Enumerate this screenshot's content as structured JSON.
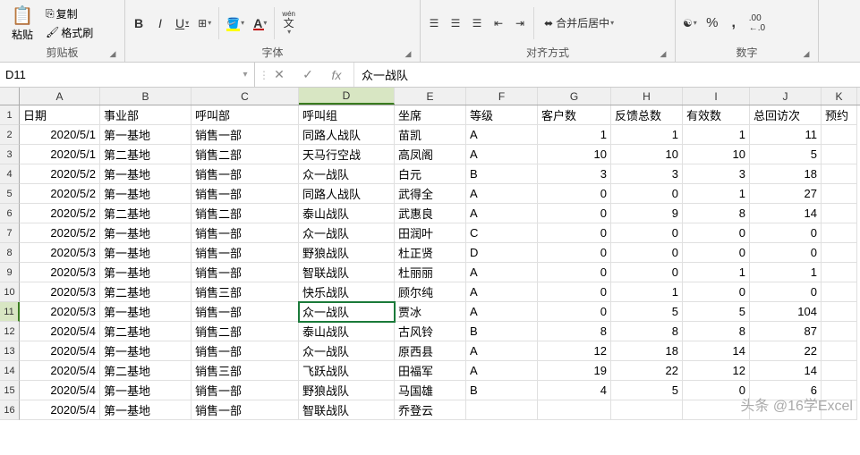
{
  "ribbon": {
    "clipboard": {
      "label": "剪贴板",
      "paste": "粘贴",
      "copy": "复制",
      "format_painter": "格式刷"
    },
    "font": {
      "label": "字体",
      "bold": "B",
      "italic": "I",
      "underline": "U",
      "wen": "wén",
      "font_color": "#c00000",
      "fill_color": "#ffff00"
    },
    "align": {
      "label": "对齐方式",
      "merge": "合并后居中"
    },
    "number": {
      "label": "数字"
    }
  },
  "name_box": "D11",
  "formula_value": "众一战队",
  "columns": [
    "A",
    "B",
    "C",
    "D",
    "E",
    "F",
    "G",
    "H",
    "I",
    "J",
    "K"
  ],
  "col_widths": [
    "cA",
    "cB",
    "cC",
    "cD",
    "cE",
    "cF",
    "cG",
    "cH",
    "cI",
    "cJ",
    "cK"
  ],
  "selected": {
    "row": 11,
    "col": "D"
  },
  "row_numbers": [
    1,
    2,
    3,
    4,
    5,
    6,
    7,
    8,
    9,
    10,
    11,
    12,
    13,
    14,
    15,
    16
  ],
  "headers": [
    "日期",
    "事业部",
    "呼叫部",
    "呼叫组",
    "坐席",
    "等级",
    "客户数",
    "反馈总数",
    "有效数",
    "总回访次",
    "预约"
  ],
  "rows": [
    [
      "2020/5/1",
      "第一基地",
      "销售一部",
      "同路人战队",
      "苗凯",
      "A",
      "1",
      "1",
      "1",
      "11",
      ""
    ],
    [
      "2020/5/1",
      "第二基地",
      "销售二部",
      "天马行空战",
      "高凤阁",
      "A",
      "10",
      "10",
      "10",
      "5",
      ""
    ],
    [
      "2020/5/2",
      "第一基地",
      "销售一部",
      "众一战队",
      "白元",
      "B",
      "3",
      "3",
      "3",
      "18",
      ""
    ],
    [
      "2020/5/2",
      "第一基地",
      "销售一部",
      "同路人战队",
      "武得全",
      "A",
      "0",
      "0",
      "1",
      "27",
      ""
    ],
    [
      "2020/5/2",
      "第二基地",
      "销售二部",
      "泰山战队",
      "武惠良",
      "A",
      "0",
      "9",
      "8",
      "14",
      ""
    ],
    [
      "2020/5/2",
      "第一基地",
      "销售一部",
      "众一战队",
      "田润叶",
      "C",
      "0",
      "0",
      "0",
      "0",
      ""
    ],
    [
      "2020/5/3",
      "第一基地",
      "销售一部",
      "野狼战队",
      "杜正贤",
      "D",
      "0",
      "0",
      "0",
      "0",
      ""
    ],
    [
      "2020/5/3",
      "第一基地",
      "销售一部",
      "智联战队",
      "杜丽丽",
      "A",
      "0",
      "0",
      "1",
      "1",
      ""
    ],
    [
      "2020/5/3",
      "第二基地",
      "销售三部",
      "快乐战队",
      "顾尔纯",
      "A",
      "0",
      "1",
      "0",
      "0",
      ""
    ],
    [
      "2020/5/3",
      "第一基地",
      "销售一部",
      "众一战队",
      "贾冰",
      "A",
      "0",
      "5",
      "5",
      "104",
      ""
    ],
    [
      "2020/5/4",
      "第二基地",
      "销售二部",
      "泰山战队",
      "古风铃",
      "B",
      "8",
      "8",
      "8",
      "87",
      ""
    ],
    [
      "2020/5/4",
      "第一基地",
      "销售一部",
      "众一战队",
      "原西县",
      "A",
      "12",
      "18",
      "14",
      "22",
      ""
    ],
    [
      "2020/5/4",
      "第二基地",
      "销售三部",
      "飞跃战队",
      "田福军",
      "A",
      "19",
      "22",
      "12",
      "14",
      ""
    ],
    [
      "2020/5/4",
      "第一基地",
      "销售一部",
      "野狼战队",
      "马国雄",
      "B",
      "4",
      "5",
      "0",
      "6",
      ""
    ],
    [
      "2020/5/4",
      "第一基地",
      "销售一部",
      "智联战队",
      "乔登云",
      "",
      "",
      "",
      "",
      "",
      ""
    ]
  ],
  "watermark": "头条 @16学Excel"
}
